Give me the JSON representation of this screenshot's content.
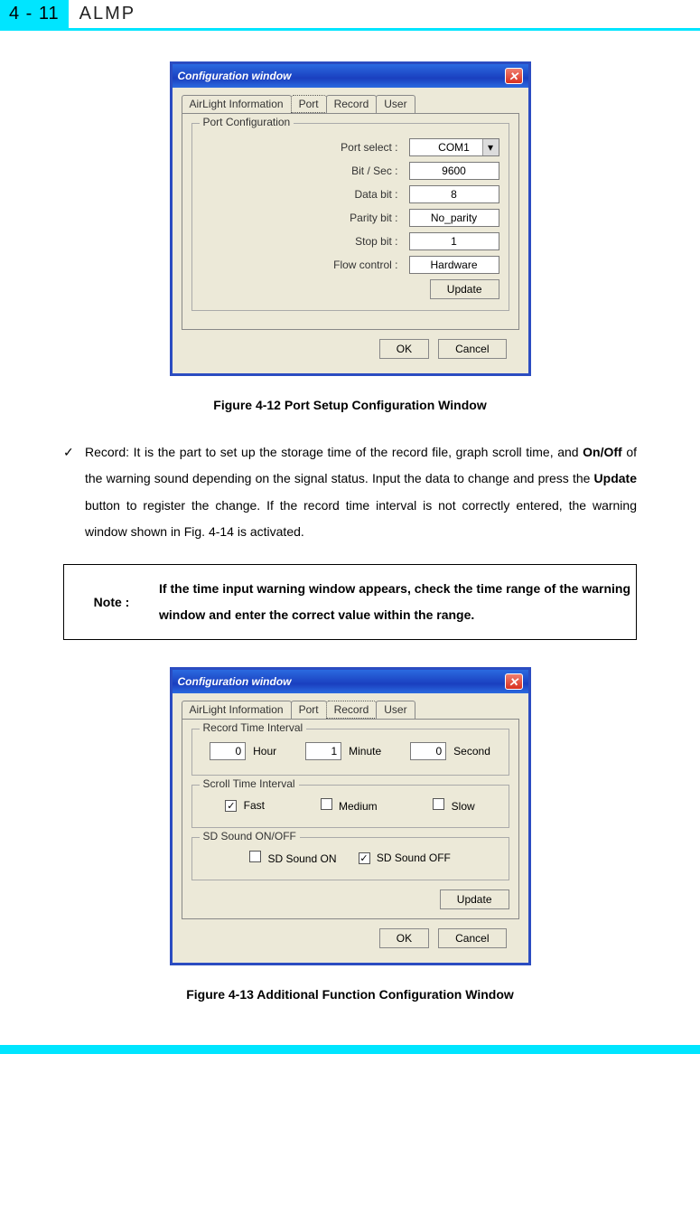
{
  "header": {
    "page_number": "4 - 11",
    "title": "ALMP"
  },
  "figure1": {
    "caption": "Figure 4-12 Port Setup Configuration Window",
    "dialog_title": "Configuration window",
    "tabs": [
      "AirLight Information",
      "Port",
      "Record",
      "User"
    ],
    "selected_tab": "Port",
    "groupbox_title": "Port Configuration",
    "fields": {
      "port_select": {
        "label": "Port select :",
        "value": "COM1"
      },
      "bit_sec": {
        "label": "Bit / Sec :",
        "value": "9600"
      },
      "data_bit": {
        "label": "Data bit :",
        "value": "8"
      },
      "parity_bit": {
        "label": "Parity bit :",
        "value": "No_parity"
      },
      "stop_bit": {
        "label": "Stop bit :",
        "value": "1"
      },
      "flow_ctrl": {
        "label": "Flow control :",
        "value": "Hardware"
      }
    },
    "update_label": "Update",
    "ok_label": "OK",
    "cancel_label": "Cancel"
  },
  "bullet": {
    "mark": "✓",
    "text_before_onoff": "Record: It is the part to set up the storage time of the record file, graph scroll time, and ",
    "onoff": "On/Off",
    "text_mid": " of the warning sound depending on the signal status. Input the data to change and press the ",
    "update_word": "Update",
    "text_after": " button to register the change. If the record time interval is not correctly entered, the warning window shown in Fig. 4-14 is activated."
  },
  "note": {
    "label": "Note :",
    "text": "If the time input warning window appears, check the time range of the warning window and enter the correct value within the range."
  },
  "figure2": {
    "caption": "Figure 4-13 Additional Function Configuration Window",
    "dialog_title": "Configuration window",
    "tabs": [
      "AirLight Information",
      "Port",
      "Record",
      "User"
    ],
    "selected_tab": "Record",
    "group_record": {
      "title": "Record Time Interval",
      "hour_value": "0",
      "hour_label": "Hour",
      "min_value": "1",
      "min_label": "Minute",
      "sec_value": "0",
      "sec_label": "Second"
    },
    "group_scroll": {
      "title": "Scroll Time Interval",
      "fast": "Fast",
      "medium": "Medium",
      "slow": "Slow",
      "fast_checked": "✓"
    },
    "group_sound": {
      "title": "SD Sound ON/OFF",
      "on_label": "SD Sound ON",
      "off_label": "SD Sound OFF",
      "off_checked": "✓"
    },
    "update_label": "Update",
    "ok_label": "OK",
    "cancel_label": "Cancel"
  }
}
